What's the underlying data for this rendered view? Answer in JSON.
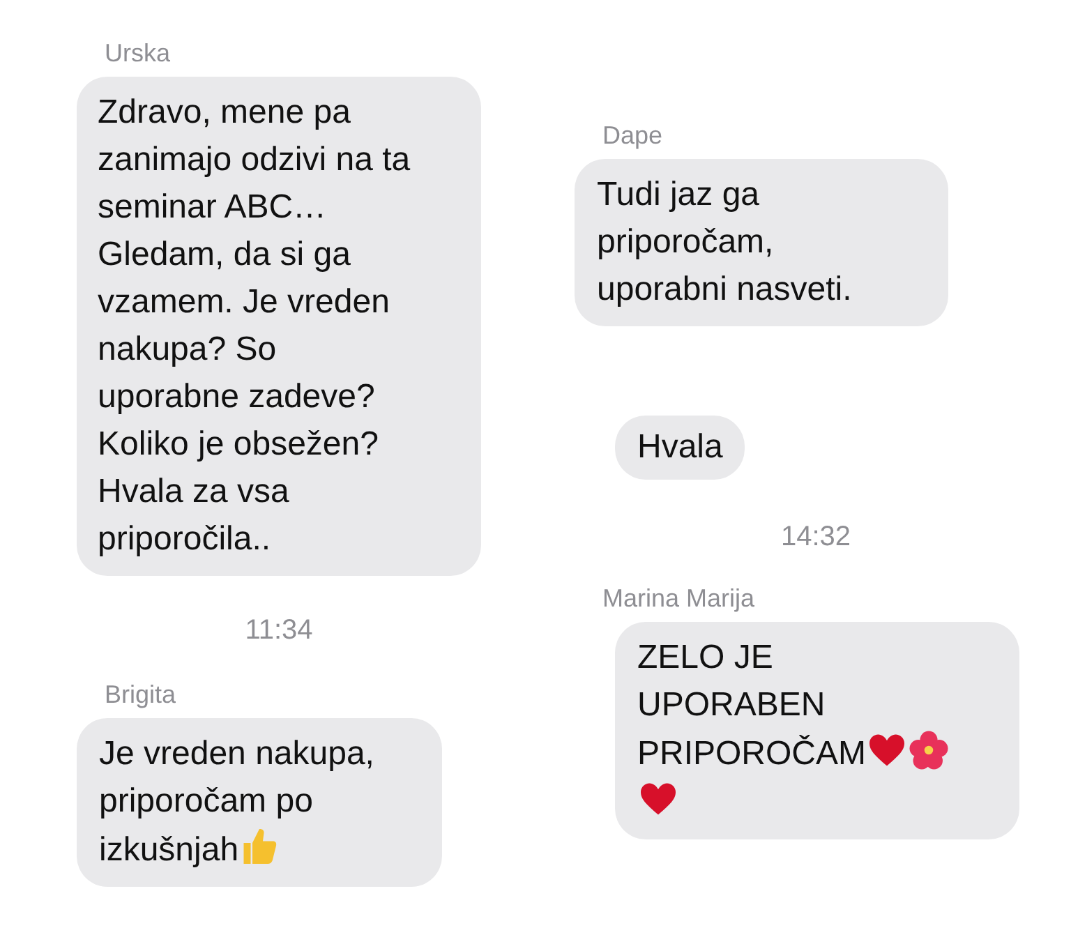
{
  "columns": [
    {
      "items": [
        {
          "kind": "sender",
          "text": "Urska"
        },
        {
          "kind": "message",
          "text": "Zdravo, mene pa\nzanimajo odzivi na ta\nseminar ABC…\nGledam, da si ga\nvzamem. Je vreden\nnakupa? So\nuporabne zadeve?\nKoliko je obsežen?\nHvala za vsa\npriporočila.."
        },
        {
          "kind": "time",
          "text": "11:34"
        },
        {
          "kind": "sender",
          "text": "Brigita"
        },
        {
          "kind": "message",
          "text": "Je vreden nakupa,\npriporočam po\nizkušnjah",
          "icons": [
            {
              "kind": "thumbs_up"
            }
          ]
        }
      ]
    },
    {
      "items": [
        {
          "kind": "sender",
          "text": "Dape"
        },
        {
          "kind": "message",
          "text": "Tudi jaz ga\npriporočam,\nuporabni nasveti."
        },
        {
          "kind": "message",
          "text": "Hvala"
        },
        {
          "kind": "time",
          "text": "14:32"
        },
        {
          "kind": "sender",
          "text": "Marina Marija"
        },
        {
          "kind": "message",
          "text": "ZELO JE\nUPORABEN\nPRIPOROČAM",
          "icons": [
            {
              "kind": "heart"
            },
            {
              "kind": "flower"
            },
            {
              "kind": "heart"
            }
          ]
        }
      ]
    }
  ]
}
